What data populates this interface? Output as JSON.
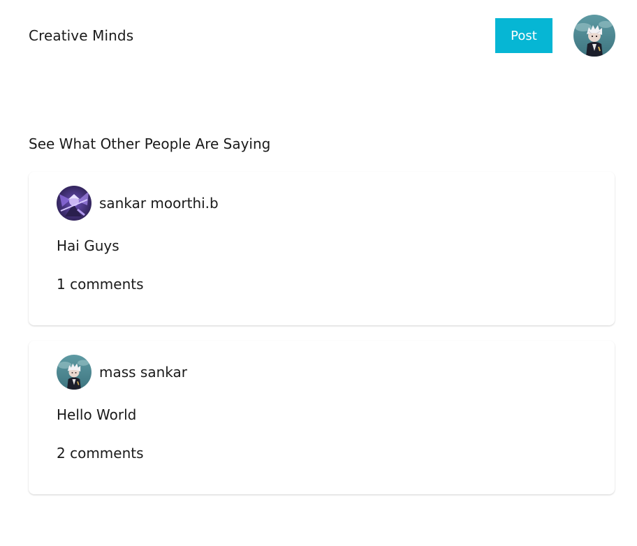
{
  "header": {
    "brand": "Creative Minds",
    "post_label": "Post",
    "user_avatar_icon": "user-avatar-icon"
  },
  "feed": {
    "title": "See What Other People Are Saying",
    "posts": [
      {
        "author": "sankar moorthi.b",
        "text": "Hai Guys",
        "comments": "1 comments",
        "avatar_icon": "author-avatar-icon"
      },
      {
        "author": "mass sankar",
        "text": "Hello World",
        "comments": "2 comments",
        "avatar_icon": "author-avatar-icon"
      }
    ]
  },
  "colors": {
    "accent": "#06b6d4",
    "text": "#1a1a1a",
    "background": "#ffffff"
  }
}
